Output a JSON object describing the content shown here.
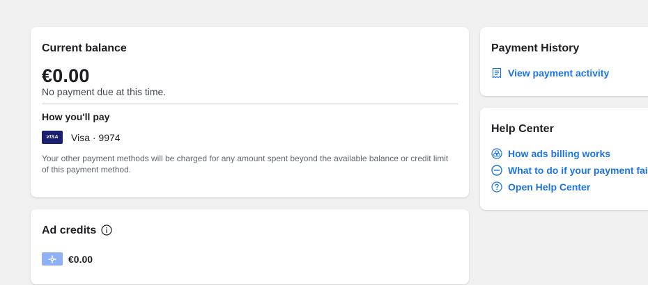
{
  "balance": {
    "title": "Current balance",
    "amount": "€0.00",
    "status": "No payment due at this time.",
    "how_you_pay_heading": "How you'll pay",
    "card_brand_badge": "VISA",
    "card_label": "Visa · 9974",
    "note": "Your other payment methods will be charged for any amount spent beyond the available balance or credit limit of this payment method."
  },
  "ad_credits": {
    "title": "Ad credits",
    "amount": "€0.00"
  },
  "payment_history": {
    "title": "Payment History",
    "link": "View payment activity"
  },
  "help_center": {
    "title": "Help Center",
    "links": [
      {
        "label": "How ads billing works",
        "icon": "billing-icon"
      },
      {
        "label": "What to do if your payment fails",
        "icon": "minus-circle-icon"
      },
      {
        "label": "Open Help Center",
        "icon": "question-circle-icon"
      }
    ]
  },
  "colors": {
    "link": "#1b74e4",
    "visa_badge": "#1a1f71",
    "credit_badge": "#8fb0f7",
    "background": "#f0f0f0"
  }
}
